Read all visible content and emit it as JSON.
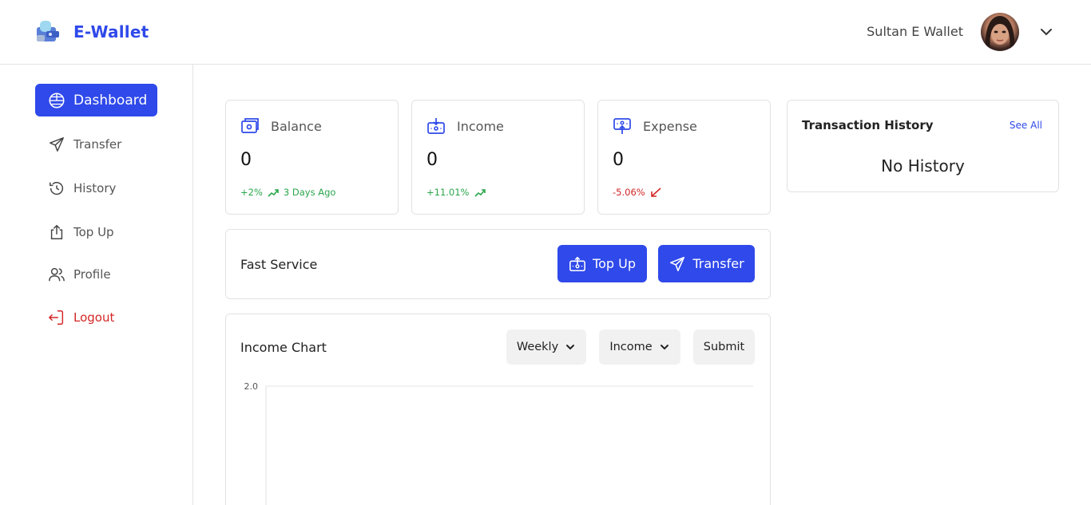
{
  "header": {
    "brand": "E-Wallet",
    "user_name": "Sultan E Wallet"
  },
  "sidebar": {
    "items": [
      {
        "label": "Dashboard",
        "icon": "globe-icon"
      },
      {
        "label": "Transfer",
        "icon": "send-icon"
      },
      {
        "label": "History",
        "icon": "history-icon"
      },
      {
        "label": "Top Up",
        "icon": "upload-icon"
      },
      {
        "label": "Profile",
        "icon": "users-icon"
      },
      {
        "label": "Logout",
        "icon": "logout-icon"
      }
    ]
  },
  "stats": {
    "balance": {
      "title": "Balance",
      "value": "0",
      "change": "+2%",
      "since": "3 Days Ago"
    },
    "income": {
      "title": "Income",
      "value": "0",
      "change": "+11.01%"
    },
    "expense": {
      "title": "Expense",
      "value": "0",
      "change": "-5.06%"
    }
  },
  "fast_service": {
    "title": "Fast Service",
    "topup_label": "Top Up",
    "transfer_label": "Transfer"
  },
  "income_chart": {
    "title": "Income Chart",
    "period": "Weekly",
    "type": "Income",
    "submit_label": "Submit"
  },
  "history": {
    "title": "Transaction History",
    "see_all": "See All",
    "empty": "No History"
  },
  "chart_data": {
    "type": "line",
    "categories": [],
    "values": [],
    "ylim": [
      0,
      2.0
    ],
    "y_ticks": [
      "2.0"
    ]
  },
  "colors": {
    "primary": "#2f49ea",
    "positive": "#2aa64c",
    "negative": "#d32626"
  }
}
